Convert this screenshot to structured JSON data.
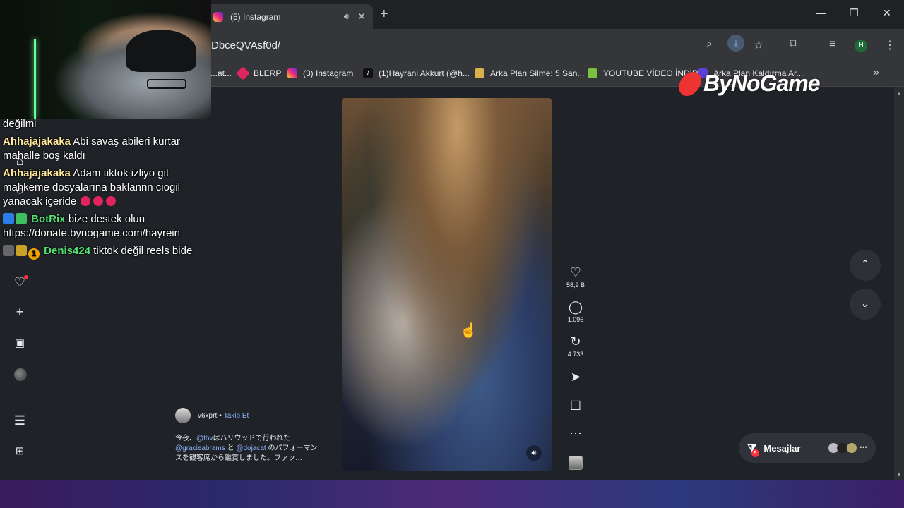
{
  "browser": {
    "tab_title": "(5) Instagram",
    "url": "DbceQVAsf0d/",
    "profile_initial": "H",
    "bookmarks": [
      {
        "label": "...at...",
        "color": "#666"
      },
      {
        "label": "BLERP",
        "color": "#e0245e"
      },
      {
        "label": "(3) Instagram",
        "color": "#d6249f"
      },
      {
        "label": "(1)Hayrani Akkurt (@h...",
        "color": "#111"
      },
      {
        "label": "Arka Plan Silme: 5 San...",
        "color": "#d9b34a"
      },
      {
        "label": "YOUTUBE VİDEO İNDİR",
        "color": "#7ac142"
      },
      {
        "label": "Arka Plan Kaldırma Ar...",
        "color": "#5b3fd6"
      }
    ]
  },
  "chat": {
    "partial_first": "değilmi",
    "messages": [
      {
        "user": "Ahhajajakaka",
        "text": "Abi savaş abileri kurtar mahalle boş kaldı",
        "color": "yellow"
      },
      {
        "user": "Ahhajajakaka",
        "text": "Adam tiktok izliyo git mahkeme dosyalarına baklannn ciogil yanacak içeride",
        "color": "yellow",
        "emotes": 3
      },
      {
        "user": "BotRix",
        "text": "bize destek olun https://donate.bynogame.com/hayrein",
        "color": "green"
      },
      {
        "user": "Denis424",
        "text": "tiktok değil reels bide",
        "color": "green",
        "badge": "1"
      }
    ]
  },
  "watermark": "ByNoGame",
  "post": {
    "author": "v6xprt",
    "follow": "Takip Et",
    "separator": "•",
    "caption_prefix": "今夜、",
    "caption_mention1": "@thv",
    "caption_mid1": "はハリウッドで行われた",
    "caption_mention2": "@gracieabrams",
    "caption_mid2": " と ",
    "caption_mention3": "@dojacat",
    "caption_mid3": " のパフォーマンスを観客席から鑑賞しました。ファッ…",
    "likes": "58,9 B",
    "comments": "1.096",
    "reposts": "4.733"
  },
  "messages_button": {
    "label": "Mesajlar",
    "badge": "5"
  }
}
